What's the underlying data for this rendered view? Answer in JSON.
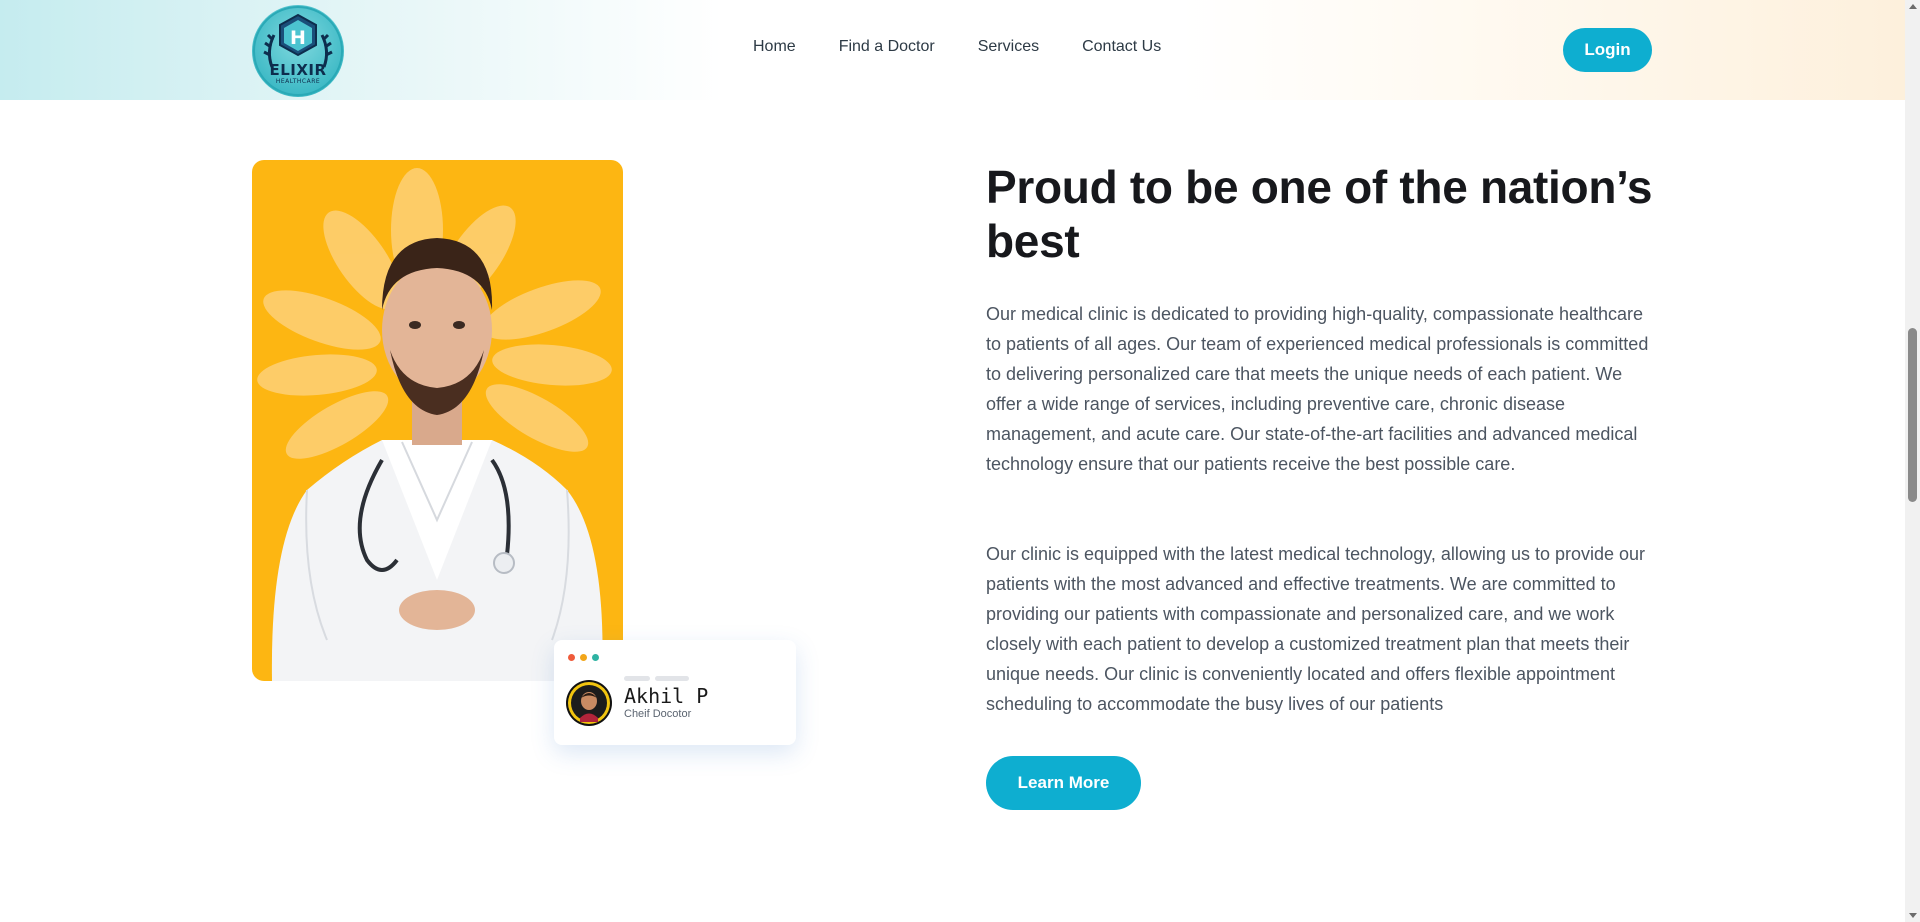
{
  "header": {
    "logo": {
      "word": "ELIXIR",
      "sub": "HEALTHCARE",
      "monogram": "H"
    },
    "nav": [
      {
        "label": "Home"
      },
      {
        "label": "Find a Doctor"
      },
      {
        "label": "Services"
      },
      {
        "label": "Contact Us"
      }
    ],
    "login_label": "Login"
  },
  "about": {
    "headline": "Proud to be one of the nation’s best",
    "paragraphs": [
      "Our medical clinic is dedicated to providing high-quality, compassionate healthcare to patients of all ages. Our team of experienced medical professionals is committed to delivering personalized care that meets the unique needs of each patient. We offer a wide range of services, including preventive care, chronic disease management, and acute care. Our state-of-the-art facilities and advanced medical technology ensure that our patients receive the best possible care.",
      "Our clinic is equipped with the latest medical technology, allowing us to provide our patients with the most advanced and effective treatments. We are committed to providing our patients with compassionate and personalized care, and we work closely with each patient to develop a customized treatment plan that meets their unique needs. Our clinic is conveniently located and offers flexible appointment scheduling to accommodate the busy lives of our patients"
    ],
    "cta_label": "Learn More"
  },
  "doctor_card": {
    "name": "Akhil P",
    "role": "Cheif Docotor"
  },
  "colors": {
    "accent": "#0eaed0",
    "photo_bg": "#fdb612",
    "headline": "#17181c",
    "body_text": "#4c5561"
  },
  "icons": {
    "logo": "hospital-h-emblem",
    "window_dots": [
      "red-dot",
      "yellow-dot",
      "green-dot"
    ]
  }
}
